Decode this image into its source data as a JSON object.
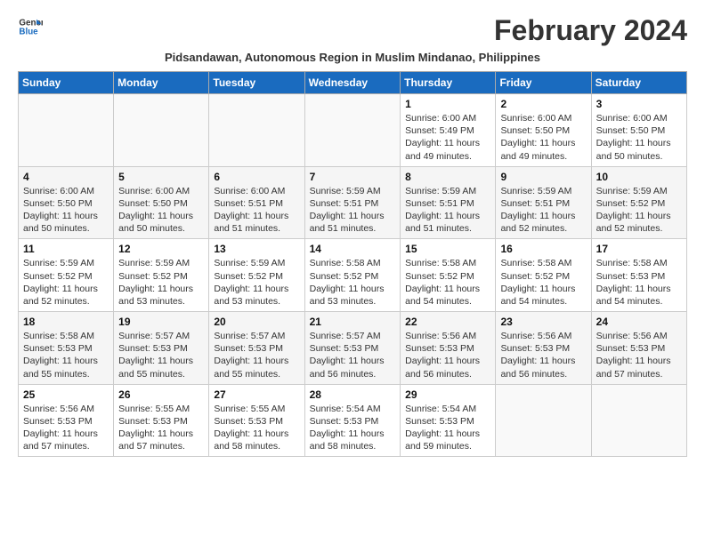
{
  "logo": {
    "line1": "General",
    "line2": "Blue"
  },
  "title": "February 2024",
  "subtitle": "Pidsandawan, Autonomous Region in Muslim Mindanao, Philippines",
  "days_of_week": [
    "Sunday",
    "Monday",
    "Tuesday",
    "Wednesday",
    "Thursday",
    "Friday",
    "Saturday"
  ],
  "weeks": [
    [
      {
        "day": "",
        "info": ""
      },
      {
        "day": "",
        "info": ""
      },
      {
        "day": "",
        "info": ""
      },
      {
        "day": "",
        "info": ""
      },
      {
        "day": "1",
        "info": "Sunrise: 6:00 AM\nSunset: 5:49 PM\nDaylight: 11 hours\nand 49 minutes."
      },
      {
        "day": "2",
        "info": "Sunrise: 6:00 AM\nSunset: 5:50 PM\nDaylight: 11 hours\nand 49 minutes."
      },
      {
        "day": "3",
        "info": "Sunrise: 6:00 AM\nSunset: 5:50 PM\nDaylight: 11 hours\nand 50 minutes."
      }
    ],
    [
      {
        "day": "4",
        "info": "Sunrise: 6:00 AM\nSunset: 5:50 PM\nDaylight: 11 hours\nand 50 minutes."
      },
      {
        "day": "5",
        "info": "Sunrise: 6:00 AM\nSunset: 5:50 PM\nDaylight: 11 hours\nand 50 minutes."
      },
      {
        "day": "6",
        "info": "Sunrise: 6:00 AM\nSunset: 5:51 PM\nDaylight: 11 hours\nand 51 minutes."
      },
      {
        "day": "7",
        "info": "Sunrise: 5:59 AM\nSunset: 5:51 PM\nDaylight: 11 hours\nand 51 minutes."
      },
      {
        "day": "8",
        "info": "Sunrise: 5:59 AM\nSunset: 5:51 PM\nDaylight: 11 hours\nand 51 minutes."
      },
      {
        "day": "9",
        "info": "Sunrise: 5:59 AM\nSunset: 5:51 PM\nDaylight: 11 hours\nand 52 minutes."
      },
      {
        "day": "10",
        "info": "Sunrise: 5:59 AM\nSunset: 5:52 PM\nDaylight: 11 hours\nand 52 minutes."
      }
    ],
    [
      {
        "day": "11",
        "info": "Sunrise: 5:59 AM\nSunset: 5:52 PM\nDaylight: 11 hours\nand 52 minutes."
      },
      {
        "day": "12",
        "info": "Sunrise: 5:59 AM\nSunset: 5:52 PM\nDaylight: 11 hours\nand 53 minutes."
      },
      {
        "day": "13",
        "info": "Sunrise: 5:59 AM\nSunset: 5:52 PM\nDaylight: 11 hours\nand 53 minutes."
      },
      {
        "day": "14",
        "info": "Sunrise: 5:58 AM\nSunset: 5:52 PM\nDaylight: 11 hours\nand 53 minutes."
      },
      {
        "day": "15",
        "info": "Sunrise: 5:58 AM\nSunset: 5:52 PM\nDaylight: 11 hours\nand 54 minutes."
      },
      {
        "day": "16",
        "info": "Sunrise: 5:58 AM\nSunset: 5:52 PM\nDaylight: 11 hours\nand 54 minutes."
      },
      {
        "day": "17",
        "info": "Sunrise: 5:58 AM\nSunset: 5:53 PM\nDaylight: 11 hours\nand 54 minutes."
      }
    ],
    [
      {
        "day": "18",
        "info": "Sunrise: 5:58 AM\nSunset: 5:53 PM\nDaylight: 11 hours\nand 55 minutes."
      },
      {
        "day": "19",
        "info": "Sunrise: 5:57 AM\nSunset: 5:53 PM\nDaylight: 11 hours\nand 55 minutes."
      },
      {
        "day": "20",
        "info": "Sunrise: 5:57 AM\nSunset: 5:53 PM\nDaylight: 11 hours\nand 55 minutes."
      },
      {
        "day": "21",
        "info": "Sunrise: 5:57 AM\nSunset: 5:53 PM\nDaylight: 11 hours\nand 56 minutes."
      },
      {
        "day": "22",
        "info": "Sunrise: 5:56 AM\nSunset: 5:53 PM\nDaylight: 11 hours\nand 56 minutes."
      },
      {
        "day": "23",
        "info": "Sunrise: 5:56 AM\nSunset: 5:53 PM\nDaylight: 11 hours\nand 56 minutes."
      },
      {
        "day": "24",
        "info": "Sunrise: 5:56 AM\nSunset: 5:53 PM\nDaylight: 11 hours\nand 57 minutes."
      }
    ],
    [
      {
        "day": "25",
        "info": "Sunrise: 5:56 AM\nSunset: 5:53 PM\nDaylight: 11 hours\nand 57 minutes."
      },
      {
        "day": "26",
        "info": "Sunrise: 5:55 AM\nSunset: 5:53 PM\nDaylight: 11 hours\nand 57 minutes."
      },
      {
        "day": "27",
        "info": "Sunrise: 5:55 AM\nSunset: 5:53 PM\nDaylight: 11 hours\nand 58 minutes."
      },
      {
        "day": "28",
        "info": "Sunrise: 5:54 AM\nSunset: 5:53 PM\nDaylight: 11 hours\nand 58 minutes."
      },
      {
        "day": "29",
        "info": "Sunrise: 5:54 AM\nSunset: 5:53 PM\nDaylight: 11 hours\nand 59 minutes."
      },
      {
        "day": "",
        "info": ""
      },
      {
        "day": "",
        "info": ""
      }
    ]
  ]
}
